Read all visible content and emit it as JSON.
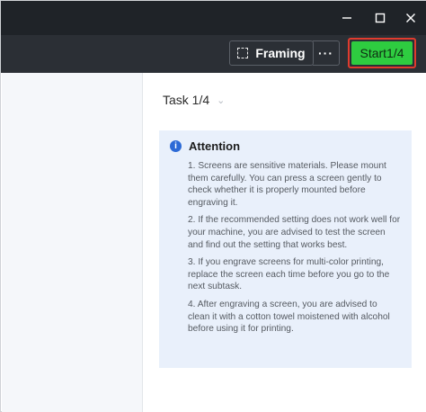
{
  "toolbar": {
    "framing_label": "Framing",
    "more_label": "···",
    "start_label": "Start1/4"
  },
  "task": {
    "label": "Task 1/4"
  },
  "attention": {
    "title": "Attention",
    "items": [
      "1. Screens are sensitive materials. Please mount them carefully. You can press a screen gently to check whether it is properly mounted before engraving it.",
      "2. If the recommended setting does not work well for your machine, you are advised to test the screen and find out the setting that works best.",
      "3. If you engrave screens for multi-color printing, replace the screen each time before you go to the next subtask.",
      "4. After engraving a screen, you are advised to clean it with a cotton towel moistened with alcohol before using it for printing."
    ]
  },
  "colors": {
    "titlebar": "#1f2328",
    "toolbar": "#2b2f35",
    "start_button": "#2ecc40",
    "highlight_border": "#e03b2e",
    "attention_bg": "#e9f0fb",
    "info_icon": "#2d6ad6"
  },
  "icons": [
    "minimize-icon",
    "maximize-icon",
    "close-icon",
    "framing-icon",
    "chevron-down-icon",
    "info-icon"
  ]
}
